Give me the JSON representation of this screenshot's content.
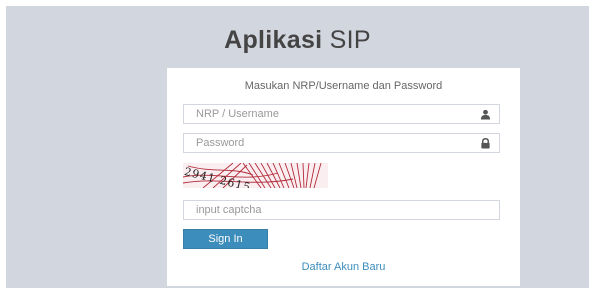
{
  "header": {
    "title_bold": "Aplikasi",
    "title_light": "SIP"
  },
  "login": {
    "message": "Masukan NRP/Username dan Password",
    "username": {
      "placeholder": "NRP / Username",
      "value": "",
      "icon": "user-icon"
    },
    "password": {
      "placeholder": "Password",
      "value": "",
      "icon": "lock-icon"
    },
    "captcha_text": "2941 2615",
    "captcha_input": {
      "placeholder": "input captcha",
      "value": ""
    },
    "signin_label": "Sign In",
    "register_label": "Daftar Akun Baru"
  },
  "colors": {
    "background": "#d2d6de",
    "primary": "#3c8dbc",
    "captcha_lines": "#b22a3a"
  }
}
